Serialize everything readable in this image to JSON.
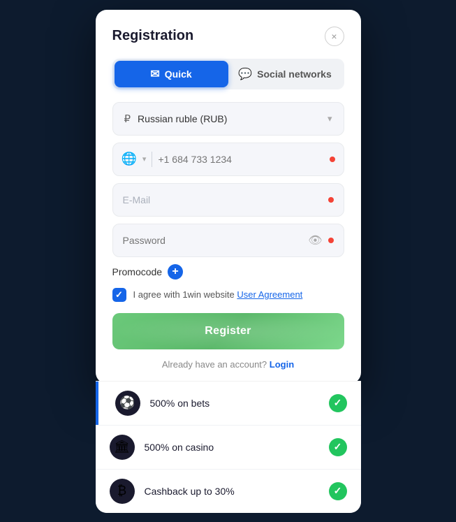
{
  "modal": {
    "title": "Registration",
    "close_label": "×",
    "tabs": [
      {
        "id": "quick",
        "label": "Quick",
        "active": true,
        "icon": "✉"
      },
      {
        "id": "social",
        "label": "Social networks",
        "active": false,
        "icon": "💬"
      }
    ],
    "currency": {
      "value": "Russian ruble (RUB)",
      "icon": "₽"
    },
    "phone": {
      "flag": "🌐",
      "placeholder": "+1 684 733 1234"
    },
    "email": {
      "placeholder": "E-Mail"
    },
    "password": {
      "placeholder": "Password"
    },
    "promocode": {
      "label": "Promocode",
      "plus_label": "+"
    },
    "agreement": {
      "text": "I agree with 1win website ",
      "link_text": "User Agreement"
    },
    "register_button": "Register",
    "already_account": "Already have an account?",
    "login_link": "Login"
  },
  "bonuses": [
    {
      "icon": "⚽",
      "text": "500% on bets",
      "checked": true
    },
    {
      "icon": "🏛",
      "text": "500% on casino",
      "checked": true
    },
    {
      "icon": "₿",
      "text": "Cashback up to 30%",
      "checked": true
    }
  ]
}
